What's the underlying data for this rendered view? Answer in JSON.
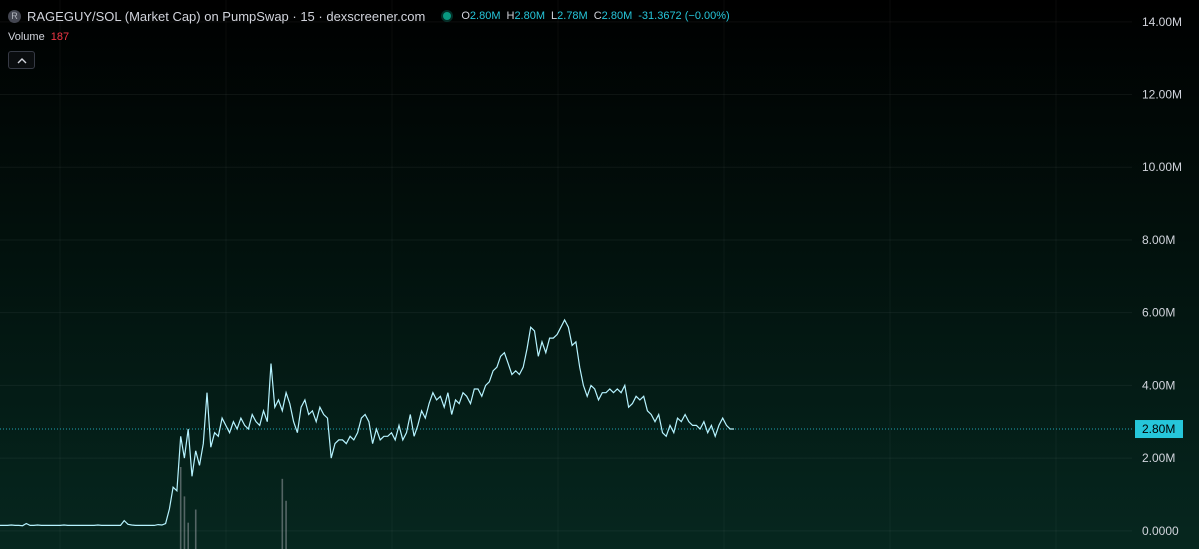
{
  "header": {
    "symbol_badge": "R",
    "title": "RAGEGUY/SOL (Market Cap) on PumpSwap · 15 · dexscreener.com",
    "ohlc": {
      "o_label": "O",
      "o_value": "2.80M",
      "h_label": "H",
      "h_value": "2.80M",
      "l_label": "L",
      "l_value": "2.78M",
      "c_label": "C",
      "c_value": "2.80M",
      "change": "-31.3672 (−0.00%)"
    },
    "volume_label": "Volume",
    "volume_value": "187",
    "collapse_icon": "chevron-up-icon"
  },
  "colors": {
    "line": "#b6f3ff",
    "accent": "#26c6da",
    "volume_text": "#f23645",
    "live_dot": "#089981"
  },
  "chart_data": {
    "type": "line",
    "title": "RAGEGUY/SOL (Market Cap) on PumpSwap · 15 · dexscreener.com",
    "ylim": [
      -0.5,
      14.6
    ],
    "y_unit": "M",
    "y_ticks": [
      {
        "value": 14,
        "label": "14.00M"
      },
      {
        "value": 12,
        "label": "12.00M"
      },
      {
        "value": 10,
        "label": "10.00M"
      },
      {
        "value": 8,
        "label": "8.00M"
      },
      {
        "value": 6,
        "label": "6.00M"
      },
      {
        "value": 4,
        "label": "4.00M"
      },
      {
        "value": 2,
        "label": "2.00M"
      },
      {
        "value": 0,
        "label": "0.0000"
      }
    ],
    "last_price": {
      "value": 2.8,
      "label": "2.80M"
    },
    "grid": true,
    "series": [
      {
        "values": [
          0.15,
          0.15,
          0.15,
          0.16,
          0.15,
          0.15,
          0.14,
          0.2,
          0.15,
          0.15,
          0.16,
          0.15,
          0.15,
          0.15,
          0.15,
          0.15,
          0.15,
          0.16,
          0.15,
          0.15,
          0.15,
          0.15,
          0.15,
          0.15,
          0.15,
          0.15,
          0.16,
          0.15,
          0.15,
          0.15,
          0.15,
          0.15,
          0.15,
          0.28,
          0.18,
          0.16,
          0.15,
          0.15,
          0.15,
          0.15,
          0.15,
          0.15,
          0.17,
          0.16,
          0.2,
          0.6,
          1.2,
          1.1,
          2.6,
          2.0,
          2.8,
          1.5,
          2.2,
          1.8,
          2.4,
          3.8,
          2.3,
          2.7,
          2.6,
          3.1,
          2.9,
          2.7,
          3.0,
          2.8,
          3.1,
          2.9,
          2.8,
          3.2,
          3.0,
          2.9,
          3.3,
          3.0,
          4.6,
          3.4,
          3.6,
          3.3,
          3.8,
          3.5,
          3.0,
          2.7,
          3.4,
          3.6,
          3.2,
          3.3,
          3.0,
          3.4,
          3.2,
          3.1,
          2.0,
          2.4,
          2.5,
          2.5,
          2.4,
          2.6,
          2.5,
          2.7,
          3.1,
          3.2,
          3.0,
          2.4,
          2.8,
          2.5,
          2.6,
          2.6,
          2.7,
          2.5,
          2.9,
          2.5,
          2.7,
          3.2,
          2.6,
          2.9,
          3.3,
          3.1,
          3.5,
          3.8,
          3.6,
          3.7,
          3.4,
          3.8,
          3.2,
          3.6,
          3.5,
          3.8,
          3.7,
          3.5,
          3.9,
          3.9,
          3.7,
          4.0,
          4.1,
          4.4,
          4.5,
          4.8,
          4.9,
          4.6,
          4.3,
          4.4,
          4.3,
          4.5,
          5.0,
          5.6,
          5.5,
          4.8,
          5.2,
          4.9,
          5.3,
          5.3,
          5.4,
          5.6,
          5.8,
          5.6,
          5.1,
          5.2,
          4.5,
          4.0,
          3.7,
          4.0,
          3.9,
          3.6,
          3.8,
          3.8,
          3.9,
          3.8,
          3.9,
          3.8,
          4.0,
          3.4,
          3.5,
          3.7,
          3.6,
          3.7,
          3.3,
          3.2,
          3.0,
          3.2,
          2.7,
          2.6,
          2.9,
          2.7,
          3.1,
          3.0,
          3.2,
          3.0,
          2.9,
          2.9,
          2.8,
          3.0,
          2.7,
          2.9,
          2.6,
          2.9,
          3.1,
          2.9,
          2.8,
          2.8
        ]
      }
    ],
    "volume": [
      {
        "index": 48,
        "value": 187
      },
      {
        "index": 49,
        "value": 120
      },
      {
        "index": 50,
        "value": 60
      },
      {
        "index": 52,
        "value": 90
      },
      {
        "index": 75,
        "value": 160
      },
      {
        "index": 76,
        "value": 110
      }
    ]
  }
}
